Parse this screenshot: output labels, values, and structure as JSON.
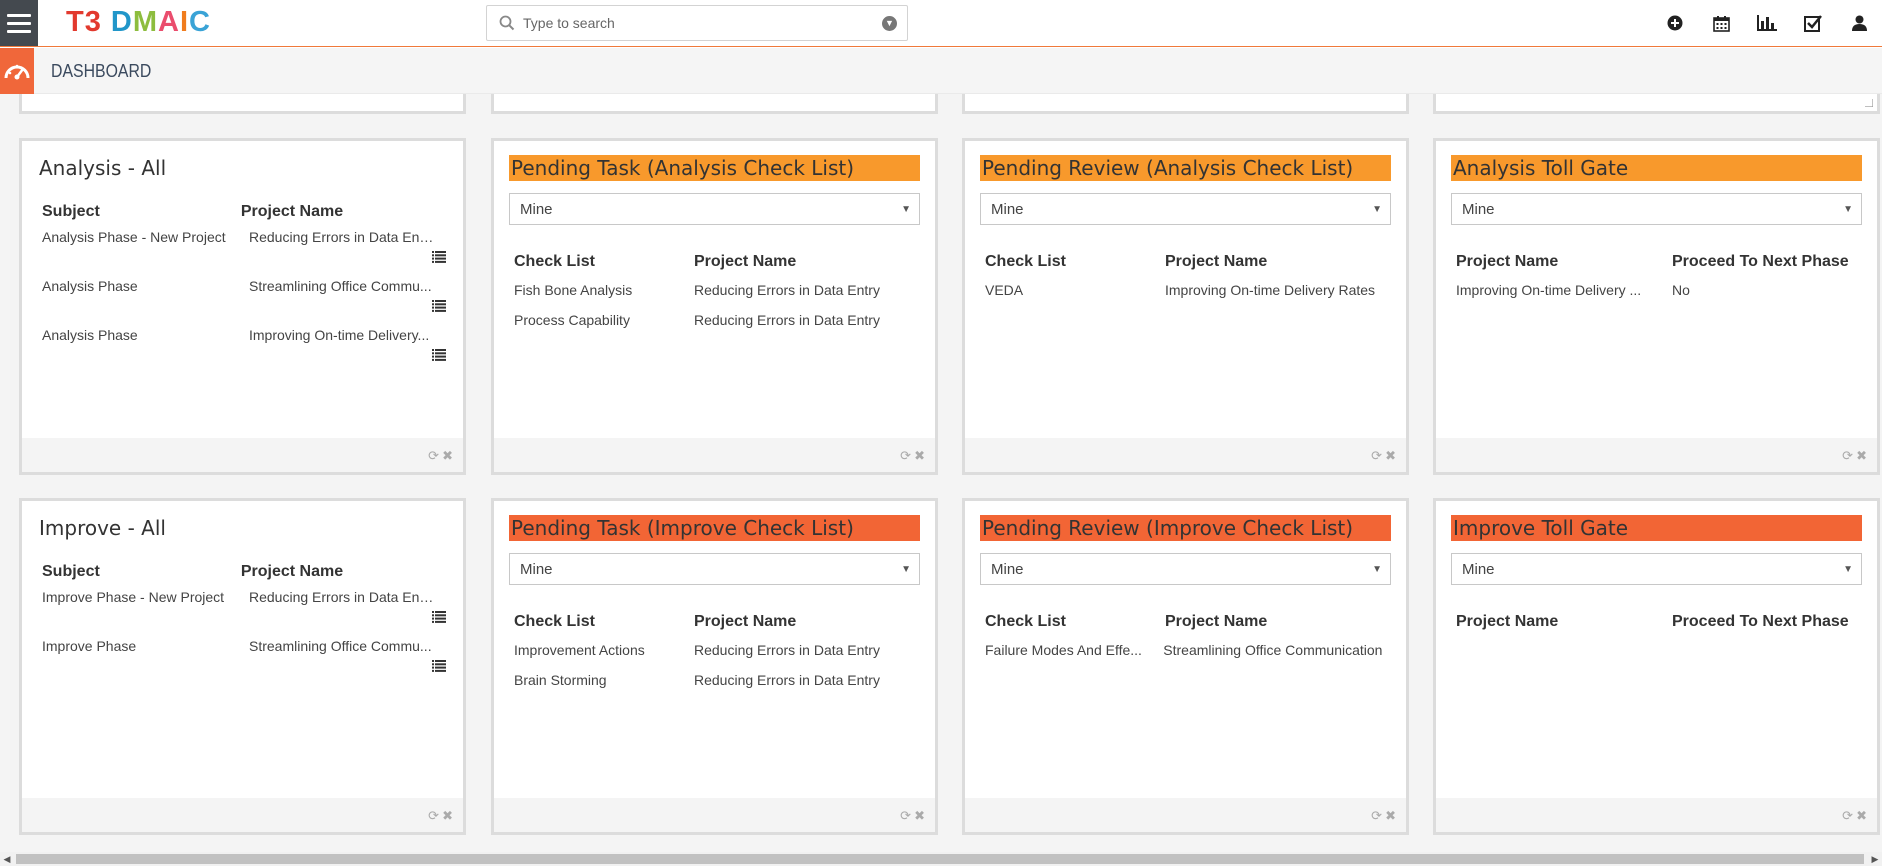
{
  "app": {
    "logo": [
      "T3",
      " ",
      "D",
      "M",
      "A",
      "I",
      "C"
    ]
  },
  "search": {
    "placeholder": "Type to search"
  },
  "top_icons": [
    "plus-circle-icon",
    "calendar-icon",
    "bar-chart-icon",
    "checkbox-icon",
    "user-icon"
  ],
  "subheader": {
    "title": "DASHBOARD"
  },
  "widgets": {
    "analysis_all": {
      "title": "Analysis - All",
      "col1": "Subject",
      "col2": "Project Name",
      "rows": [
        {
          "subject": "Analysis Phase - New Project",
          "project": "Reducing Errors in Data Ent..."
        },
        {
          "subject": "Analysis Phase",
          "project": "Streamlining Office Commu..."
        },
        {
          "subject": "Analysis Phase",
          "project": "Improving On-time Delivery..."
        }
      ]
    },
    "pending_task_analysis": {
      "title": "Pending Task (Analysis Check List)",
      "filter": "Mine",
      "col1": "Check List",
      "col2": "Project Name",
      "rows": [
        {
          "checklist": "Fish Bone Analysis",
          "project": "Reducing Errors in Data Entry"
        },
        {
          "checklist": "Process Capability",
          "project": "Reducing Errors in Data Entry"
        }
      ]
    },
    "pending_review_analysis": {
      "title": "Pending Review (Analysis Check List)",
      "filter": "Mine",
      "col1": "Check List",
      "col2": "Project Name",
      "rows": [
        {
          "checklist": "VEDA",
          "project": "Improving On-time Delivery Rates"
        }
      ]
    },
    "analysis_toll_gate": {
      "title": "Analysis Toll Gate",
      "filter": "Mine",
      "col1": "Project Name",
      "col2": "Proceed To Next Phase",
      "rows": [
        {
          "project": "Improving On-time Delivery ...",
          "proceed": "No"
        }
      ]
    },
    "improve_all": {
      "title": "Improve - All",
      "col1": "Subject",
      "col2": "Project Name",
      "rows": [
        {
          "subject": "Improve Phase - New Project",
          "project": "Reducing Errors in Data Ent..."
        },
        {
          "subject": "Improve Phase",
          "project": "Streamlining Office Commu..."
        }
      ]
    },
    "pending_task_improve": {
      "title": "Pending Task (Improve Check List)",
      "filter": "Mine",
      "col1": "Check List",
      "col2": "Project Name",
      "rows": [
        {
          "checklist": "Improvement Actions",
          "project": "Reducing Errors in Data Entry"
        },
        {
          "checklist": "Brain Storming",
          "project": "Reducing Errors in Data Entry"
        }
      ]
    },
    "pending_review_improve": {
      "title": "Pending Review (Improve Check List)",
      "filter": "Mine",
      "col1": "Check List",
      "col2": "Project Name",
      "rows": [
        {
          "checklist": "Failure Modes And Effe...",
          "project": "Streamlining Office Communication"
        }
      ]
    },
    "improve_toll_gate": {
      "title": "Improve Toll Gate",
      "filter": "Mine",
      "col1": "Project Name",
      "col2": "Proceed To Next Phase",
      "rows": []
    }
  },
  "colors": {
    "analysis_header": "#f8992c",
    "improve_header": "#f26535",
    "accent": "#f0673a"
  }
}
